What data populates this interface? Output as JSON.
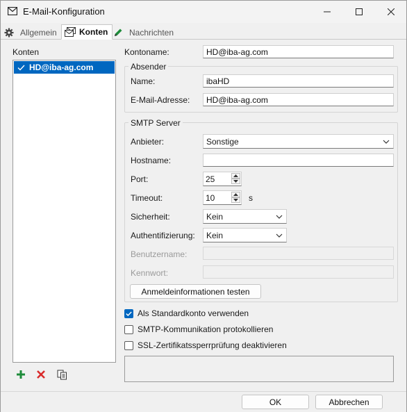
{
  "window": {
    "title": "E-Mail-Konfiguration"
  },
  "tabs": [
    {
      "label": "Allgemein",
      "icon": "gear-icon"
    },
    {
      "label": "Konten",
      "icon": "mail-accounts-icon"
    },
    {
      "label": "Nachrichten",
      "icon": "pencil-icon"
    }
  ],
  "accounts": {
    "header": "Konten",
    "items": [
      {
        "label": "HD@iba-ag.com",
        "checked": true
      }
    ]
  },
  "form": {
    "kontoname_label": "Kontoname:",
    "kontoname_value": "HD@iba-ag.com",
    "absender": {
      "title": "Absender",
      "name_label": "Name:",
      "name_value": "ibaHD",
      "email_label": "E-Mail-Adresse:",
      "email_value": "HD@iba-ag.com"
    },
    "smtp": {
      "title": "SMTP Server",
      "anbieter_label": "Anbieter:",
      "anbieter_value": "Sonstige",
      "hostname_label": "Hostname:",
      "hostname_value": "",
      "port_label": "Port:",
      "port_value": "25",
      "timeout_label": "Timeout:",
      "timeout_value": "10",
      "timeout_unit": "s",
      "sicherheit_label": "Sicherheit:",
      "sicherheit_value": "Kein",
      "auth_label": "Authentifizierung:",
      "auth_value": "Kein",
      "benutzername_label": "Benutzername:",
      "kennwort_label": "Kennwort:",
      "test_button": "Anmeldeinformationen testen"
    },
    "options": [
      {
        "label": "Als Standardkonto verwenden",
        "checked": true
      },
      {
        "label": "SMTP-Kommunikation protokollieren",
        "checked": false
      },
      {
        "label": "SSL-Zertifikatssperrprüfung deaktivieren",
        "checked": false
      }
    ]
  },
  "footer": {
    "ok": "OK",
    "cancel": "Abbrechen"
  },
  "colors": {
    "accent": "#0067c0",
    "add": "#1e8c3a",
    "delete": "#d92b2b"
  }
}
